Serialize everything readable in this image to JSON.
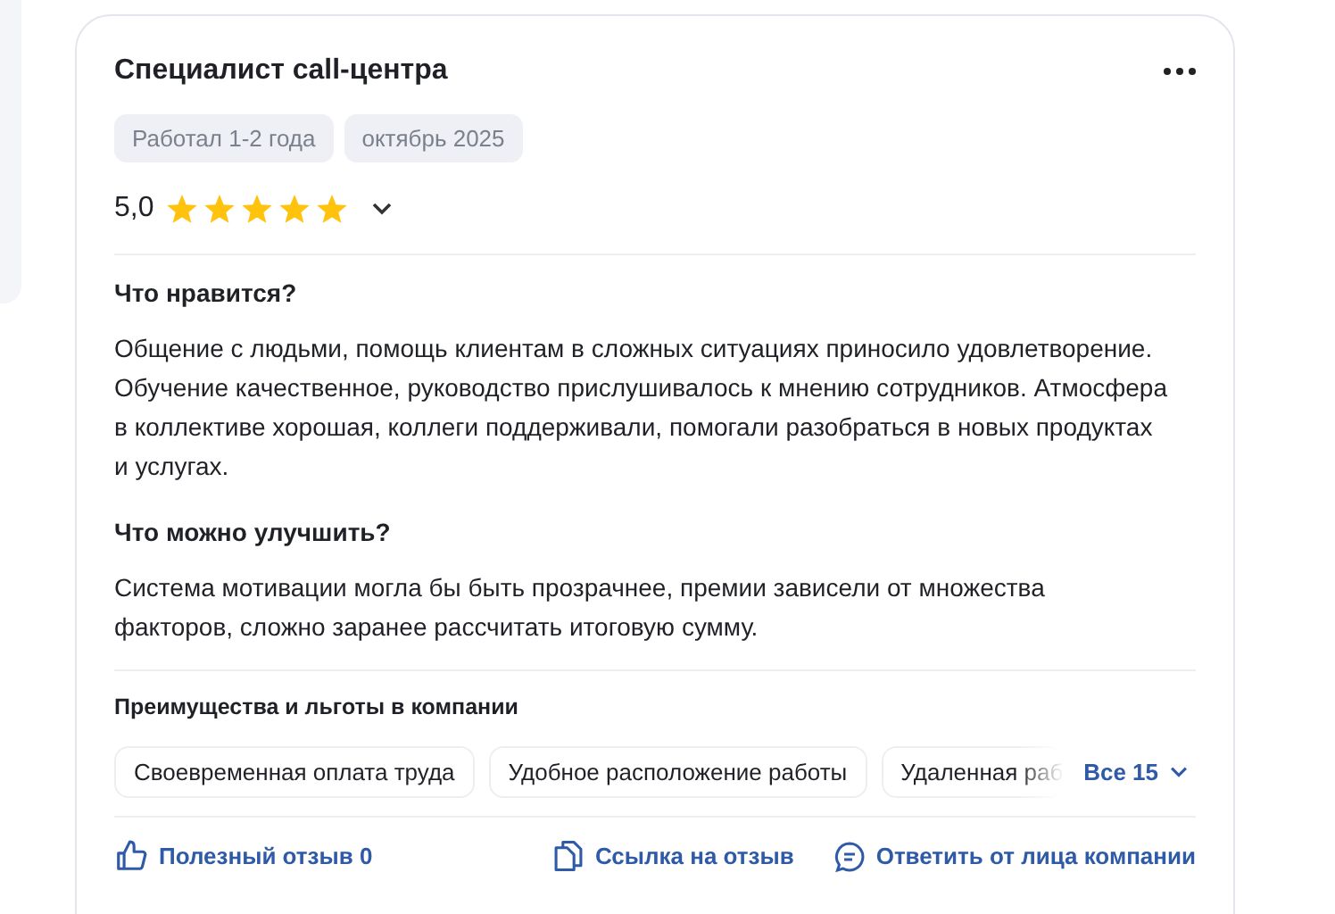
{
  "review": {
    "title": "Специалист call-центра",
    "tags": [
      "Работал 1-2 года",
      "октябрь 2025"
    ],
    "rating": "5,0",
    "stars": 5,
    "sections": [
      {
        "heading": "Что нравится?",
        "text": "Общение с людьми, помощь клиентам в сложных ситуациях приносило удовлетворение. Обучение качественное, руководство прислушивалось к мнению сотрудников. Атмосфера в коллективе хорошая, коллеги поддерживали, помогали разобраться в новых продуктах и услугах."
      },
      {
        "heading": "Что можно улучшить?",
        "text": "Система мотивации могла бы быть прозрачнее, премии зависели от множества факторов, сложно заранее рассчитать итоговую сумму."
      }
    ],
    "benefits": {
      "heading": "Преимущества и льготы в компании",
      "items": [
        "Своевременная оплата труда",
        "Удобное расположение работы",
        "Удаленная раб"
      ],
      "more": "Все 15"
    },
    "actions": [
      {
        "kind": "like",
        "label": "Полезный отзыв 0"
      },
      {
        "kind": "link",
        "label": "Ссылка на отзыв"
      },
      {
        "kind": "reply",
        "label": "Ответить от лица компании"
      }
    ]
  }
}
